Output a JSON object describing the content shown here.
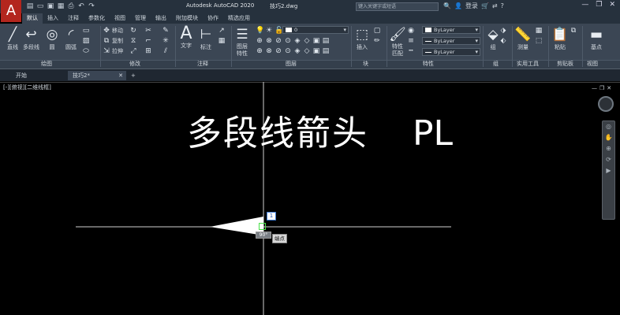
{
  "app": {
    "logo": "A",
    "title": "Autodesk AutoCAD 2020",
    "document": "技巧2.dwg"
  },
  "quick_access": [
    "▤",
    "▭",
    "▣",
    "▦",
    "⎙",
    "↶",
    "↷"
  ],
  "search": {
    "placeholder": "键入关键字或短语"
  },
  "account": {
    "login": "登录"
  },
  "ribbon_tabs": [
    "默认",
    "插入",
    "注释",
    "参数化",
    "视图",
    "管理",
    "输出",
    "附加模块",
    "协作",
    "精选应用"
  ],
  "ribbon": {
    "draw": {
      "title": "绘图",
      "line": "直线",
      "pline": "多段线",
      "circle": "圆",
      "arc": "圆弧"
    },
    "modify": {
      "title": "修改",
      "move": "移动",
      "copy": "复制",
      "stretch": "拉伸"
    },
    "annotation": {
      "title": "注释",
      "text": "文字",
      "dim": "标注"
    },
    "layers": {
      "title": "图层",
      "props": "图层\n特性",
      "layer_value": "0"
    },
    "block": {
      "title": "块",
      "insert": "插入"
    },
    "properties": {
      "title": "特性",
      "match": "特性\n匹配",
      "bylayer1": "ByLayer",
      "bylayer2": "ByLayer",
      "bylayer3": "ByLayer"
    },
    "groups": {
      "title": "组",
      "group": "组"
    },
    "utilities": {
      "title": "实用工具",
      "measure": "测量"
    },
    "clipboard": {
      "title": "剪贴板",
      "paste": "粘贴"
    },
    "view": {
      "title": "视图",
      "base": "基点"
    }
  },
  "doc_tabs": {
    "start": "开始",
    "drawing": "技巧2*",
    "add": "+"
  },
  "viewport": {
    "label": "[-][俯视][二维线框]"
  },
  "drawing": {
    "text_cn": "多段线箭头",
    "text_pl": "PL"
  },
  "tooltips": {
    "angle": "90°",
    "endpoint": "端点",
    "input": "1"
  },
  "colors": {
    "ribbon": "#3b4654",
    "title": "#26313d",
    "canvas": "#000000",
    "logo": "#b3261e"
  }
}
